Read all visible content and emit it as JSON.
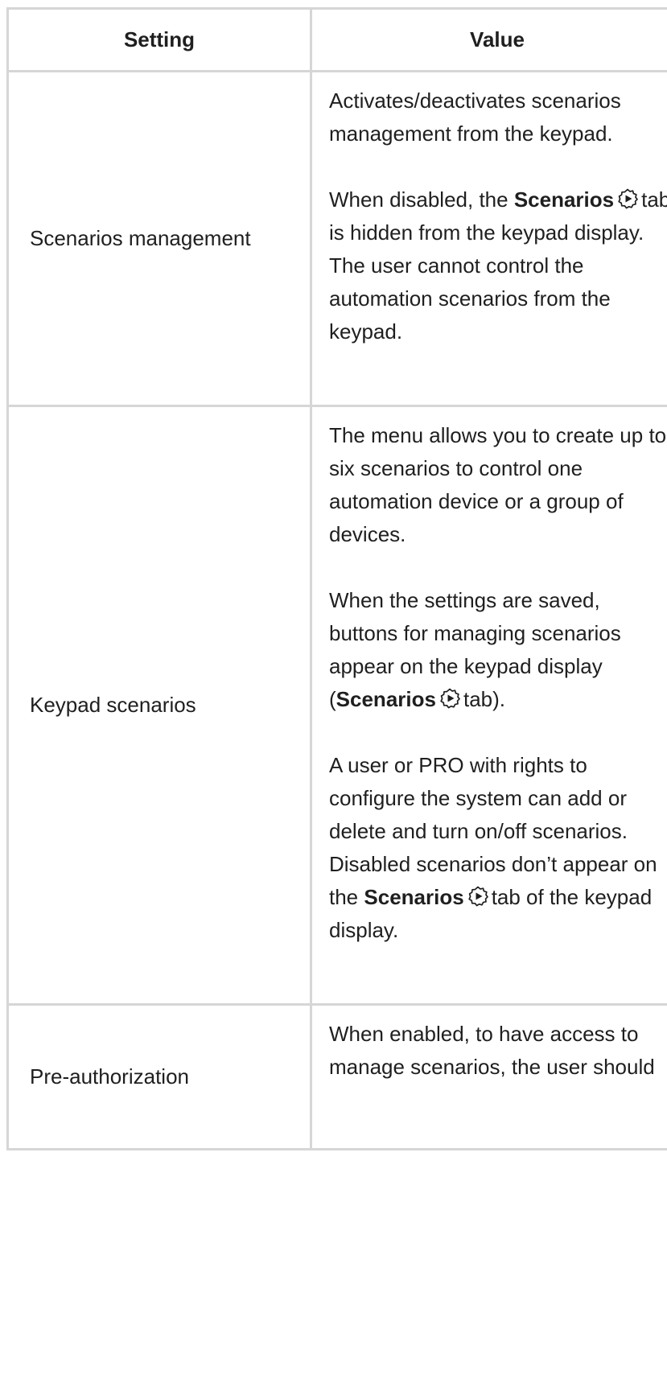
{
  "table": {
    "headers": {
      "setting": "Setting",
      "value": "Value"
    },
    "rows": [
      {
        "setting": "Scenarios management",
        "p1": "Activates/deactivates scenarios management from the keypad.",
        "p2_before": "When disabled, the",
        "p2_bold": "Scenarios",
        "p2_after": "tab is hidden from the keypad display. The user cannot control the automation scenarios from the keypad."
      },
      {
        "setting": "Keypad scenarios",
        "p1": "The menu allows you to create up to six scenarios to control one automation device or a group of devices.",
        "p2_before": "When the settings are saved, buttons for managing scenarios appear on the keypad display (",
        "p2_bold": "Scenarios",
        "p2_after": "tab).",
        "p3_before": "A user or PRO with rights to configure the system can add or delete and turn on/off scenarios. Disabled scenarios don’t appear on the",
        "p3_bold": "Scenarios",
        "p3_after": "tab of the keypad display."
      },
      {
        "setting": "Pre-authorization",
        "p1": "When enabled, to have access to manage scenarios, the user should"
      }
    ]
  },
  "icons": {
    "scenarios": "scenarios-play-icon"
  }
}
